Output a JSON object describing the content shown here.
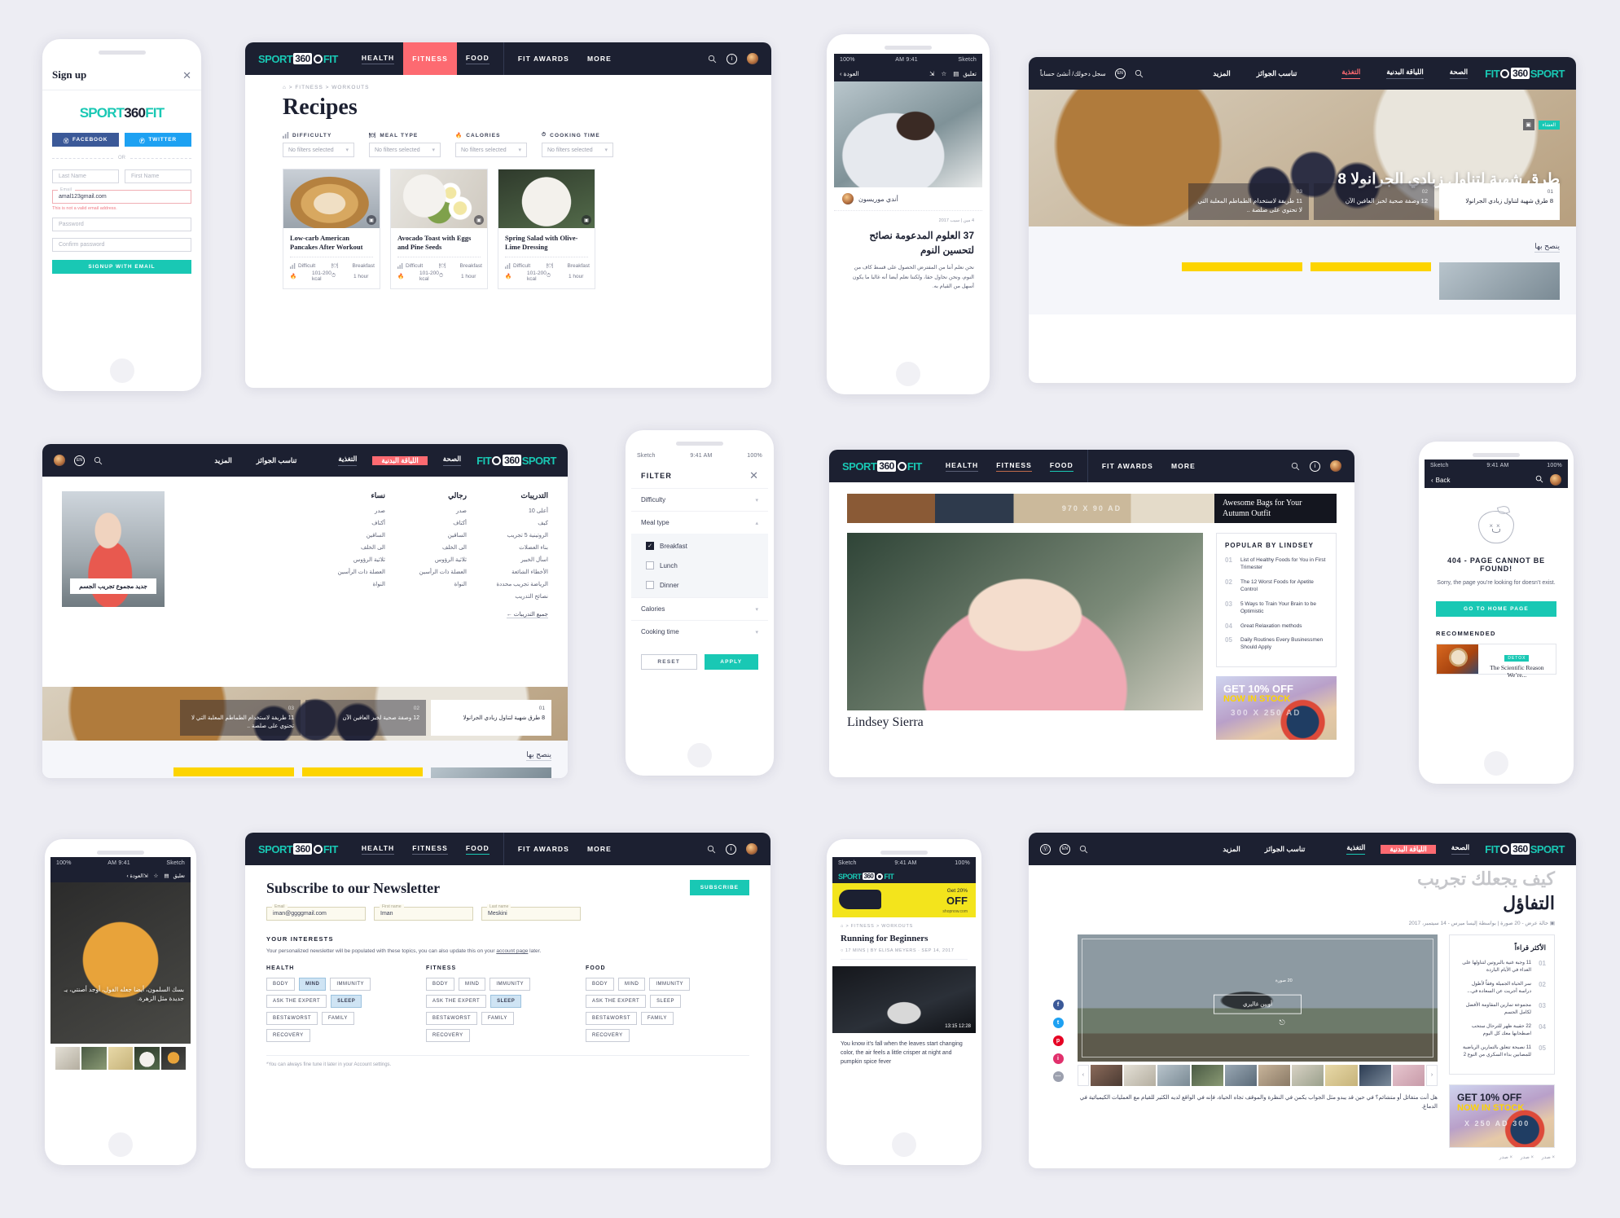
{
  "brand": {
    "part1": "SPORT",
    "part2": "360",
    "part3": "FIT",
    "accent": "#19c8b4",
    "dark": "#1c2031",
    "pink": "#fd6a71",
    "yellow": "#fdd400"
  },
  "status_bar": {
    "carrier": "Sketch",
    "time": "9:41 AM",
    "battery": "100%"
  },
  "signup": {
    "title": "Sign up",
    "close_icon": "close-icon",
    "facebook_label": "FACEBOOK",
    "twitter_label": "TWITTER",
    "or_label": "OR",
    "last_name_placeholder": "Last Name",
    "first_name_placeholder": "First Name",
    "email_label": "Email",
    "email_value": "amal123gmail.com",
    "email_error": "This is not a valid email address.",
    "password_placeholder": "Password",
    "confirm_placeholder": "Confirm password",
    "submit_label": "SIGNUP WITH EMAIL"
  },
  "desktop_nav": {
    "links": [
      "HEALTH",
      "FITNESS",
      "FOOD",
      "FIT AWARDS",
      "MORE"
    ],
    "active": "FITNESS",
    "search_icon": "search-icon",
    "info_icon": "info-icon",
    "avatar_icon": "avatar"
  },
  "recipes": {
    "breadcrumb": "⌂  >  FITNESS  >  WORKOUTS",
    "title": "Recipes",
    "filters": [
      {
        "icon": "bar-chart-icon",
        "label": "DIFFICULTY",
        "value": "No filters selected"
      },
      {
        "icon": "meal-icon",
        "label": "MEAL TYPE",
        "value": "No filters selected"
      },
      {
        "icon": "flame-icon",
        "label": "CALORIES",
        "value": "No filters selected"
      },
      {
        "icon": "clock-icon",
        "label": "COOKING TIME",
        "value": "No filters selected"
      }
    ],
    "cards": [
      {
        "title": "Low-carb American Pancakes After Workout",
        "difficulty": "Difficult",
        "meal": "Breakfast",
        "calories": "101-200 kcal",
        "time": "1 hour",
        "photo": "ph-pancake"
      },
      {
        "title": "Avocado Toast with Eggs and Pine Seeds",
        "difficulty": "Difficult",
        "meal": "Breakfast",
        "calories": "101-200 kcal",
        "time": "1 hour",
        "photo": "ph-avocado"
      },
      {
        "title": "Spring Salad with Olive-Lime Dressing",
        "difficulty": "Difficult",
        "meal": "Breakfast",
        "calories": "101-200 kcal",
        "time": "1 hour",
        "photo": "ph-salad"
      }
    ]
  },
  "sleep_article": {
    "back_label": "العودة",
    "comment_label": "تعليق",
    "star_icon": "star-icon",
    "share_icon": "share-icon",
    "author": "أندي موريسون",
    "meta": "4 مين | سيب 2017",
    "title": "37 العلوم المدعومة نصائح لتحسين النوم",
    "body": "نحن نعلم أننا من المفترض الحصول على قسط كاف من النوم، ونحن نحاول حقا، ولكننا نعلم أيضا أنه غالبا ما يكون أسهل من القيام به."
  },
  "arabic_nav": {
    "links": [
      "الصحة",
      "اللياقة البدنية",
      "التغذية",
      "تناسب الجوائز",
      "المزيد"
    ],
    "auth": "سجل دخولك/ أنشئ حساباً",
    "lang_badge": "EN",
    "search_icon": "search-icon"
  },
  "granola_hero": {
    "tag": "العشاء",
    "gallery_icon": "gallery-icon",
    "title": "8 طرق شهية لتناول زبادي الجرانولا",
    "cards": [
      {
        "n": "01",
        "text": "8 طرق شهية لتناول زبادي الجرانولا",
        "active": true
      },
      {
        "n": "02",
        "text": "12 وصفة صحية لخبز العافين الآن",
        "active": false
      },
      {
        "n": "03",
        "text": "11 طريفة لاستخدام الطماطم المعلبة التي لا تحتوي على صلصة ..",
        "active": false
      }
    ],
    "recommend_label": "ينصح بها"
  },
  "mega_menu": {
    "columns": [
      {
        "heading": "التدريبات",
        "items": [
          "أعلى 10",
          "كيف",
          "الروتينية 5 تجريب",
          "بناء العضلات",
          "اسأل الخبير",
          "الأخطاء الشائعة",
          "الرياضة تجريب محددة",
          "نصائح التدريب"
        ],
        "all_label": "جميع التدريبات ←"
      },
      {
        "heading": "رجالي",
        "items": [
          "صدر",
          "أكتاف",
          "الساقين",
          "الى الخلف",
          "ثلاثية الرؤوس",
          "العضلة ذات الرأسين",
          "النواة"
        ],
        "all_label": ""
      },
      {
        "heading": "نساء",
        "items": [
          "صدر",
          "أكتاف",
          "الساقين",
          "الى الخلف",
          "ثلاثية الرؤوس",
          "العضلة ذات الرأسين",
          "النواة"
        ],
        "all_label": ""
      }
    ],
    "promo_caption": "جديد مجموع تجريب الجسم"
  },
  "filter_panel": {
    "title": "FILTER",
    "close_icon": "close-icon",
    "rows": [
      {
        "label": "Difficulty",
        "state": "collapsed"
      },
      {
        "label": "Meal type",
        "state": "expanded"
      },
      {
        "label": "Calories",
        "state": "collapsed"
      },
      {
        "label": "Cooking time",
        "state": "collapsed"
      }
    ],
    "meal_options": [
      {
        "label": "Breakfast",
        "checked": true
      },
      {
        "label": "Lunch",
        "checked": false
      },
      {
        "label": "Dinner",
        "checked": false
      }
    ],
    "reset_label": "RESET",
    "apply_label": "APPLY"
  },
  "lindsey_page": {
    "ad_label": "970 X 90 AD",
    "ad_caption": "Awesome Bags for Your Autumn Outfit",
    "article_name": "Lindsey Sierra",
    "popular_heading": "POPULAR BY LINDSEY",
    "popular": [
      {
        "n": "01",
        "title": "List of Healthy Foods for You in First Trimester"
      },
      {
        "n": "02",
        "title": "The 12 Worst Foods for Apetite Control"
      },
      {
        "n": "03",
        "title": "5 Ways to Train Your Brain to be Optimistic"
      },
      {
        "n": "04",
        "title": "Great Relaxation methods"
      },
      {
        "n": "05",
        "title": "Daily Routines Every Businessmen Should Apply"
      }
    ],
    "ad_line1": "GET 10% OFF",
    "ad_line2": "NOW IN STOCK",
    "ad_line3": "300 X 250 AD"
  },
  "error_page": {
    "back_label": "Back",
    "search_icon": "search-icon",
    "avatar_icon": "avatar",
    "apple_icon": "sad-apple-icon",
    "heading": "404 - PAGE CANNOT BE FOUND!",
    "body": "Sorry, the page you’re looking for doesn’t exist.",
    "cta_label": "GO TO HOME PAGE",
    "recommended_label": "RECOMMENDED",
    "rec_tag": "DETOX",
    "rec_title": "The Scientific Reason We’re..."
  },
  "newsletter": {
    "title": "Subscribe to our Newsletter",
    "subscribe_label": "SUBSCRIBE",
    "fields": [
      {
        "label": "Email",
        "value": "iman@ggggmail.com"
      },
      {
        "label": "First name",
        "value": "Iman"
      },
      {
        "label": "Last name",
        "value": "Meskini"
      }
    ],
    "interests_heading": "YOUR INTERESTS",
    "interests_note_a": "Your personalized newsletter will be populated with these topics, you can also update this on your ",
    "interests_note_link": "account page",
    "interests_note_b": " later.",
    "columns": [
      {
        "heading": "HEALTH",
        "tags": [
          {
            "label": "BODY",
            "on": false
          },
          {
            "label": "MIND",
            "on": true
          },
          {
            "label": "IMMUNITY",
            "on": false
          },
          {
            "label": "ASK THE EXPERT",
            "on": false
          },
          {
            "label": "SLEEP",
            "on": true
          },
          {
            "label": "BEST&WORST",
            "on": false
          },
          {
            "label": "FAMILY",
            "on": false
          },
          {
            "label": "RECOVERY",
            "on": false
          }
        ]
      },
      {
        "heading": "FITNESS",
        "tags": [
          {
            "label": "BODY",
            "on": false
          },
          {
            "label": "MIND",
            "on": false
          },
          {
            "label": "IMMUNITY",
            "on": false
          },
          {
            "label": "ASK THE EXPERT",
            "on": false
          },
          {
            "label": "SLEEP",
            "on": true
          },
          {
            "label": "BEST&WORST",
            "on": false
          },
          {
            "label": "FAMILY",
            "on": false
          },
          {
            "label": "RECOVERY",
            "on": false
          }
        ]
      },
      {
        "heading": "FOOD",
        "tags": [
          {
            "label": "BODY",
            "on": false
          },
          {
            "label": "MIND",
            "on": false
          },
          {
            "label": "IMMUNITY",
            "on": false
          },
          {
            "label": "ASK THE EXPERT",
            "on": false
          },
          {
            "label": "SLEEP",
            "on": false
          },
          {
            "label": "BEST&WORST",
            "on": false
          },
          {
            "label": "FAMILY",
            "on": false
          },
          {
            "label": "RECOVERY",
            "on": false
          }
        ]
      }
    ],
    "footnote": "*You can always fine tune it later in your Account settings."
  },
  "paella_phone": {
    "back_label": "العودة",
    "comment_label": "تعليق",
    "caption": "بسك السلمون، أيضا جعله الفول، أوجد أصنتي، يـ جديدة مثل الزهرة."
  },
  "running_phone": {
    "ad_small": "Get 20%",
    "ad_big": "OFF",
    "ad_note": "shopnow.com",
    "breadcrumb": "⌂  >  FITNESS  >  WORKOUTS",
    "title": "Running for Beginners",
    "meta": "○ 17 MINS  |  BY ELISA MEYERS · SEP 14, 2017",
    "img_time": "13:15      12:28",
    "body": "You know it’s fall when the leaves start changing color, the air feels a little crisper at night and pumpkin spice fever"
  },
  "gallery_page": {
    "title_line1": "كيف يجعلك تجريب",
    "title_line2": "التفاؤل",
    "meta": "حالة عرض - 20 صورة  |  بواسطة إليسا ميرس - 14 سيتمبر، 2017",
    "most_read_heading": "الأكثر قراءاً",
    "most_read": [
      {
        "n": "01",
        "t": "11 وجبة غنية بالبروتين لتناولها على الغداء في الأيام الباردة"
      },
      {
        "n": "02",
        "t": "سر الحياة الجميلة وفقاً لأطول دراسة أجريت عن السعادة في..."
      },
      {
        "n": "03",
        "t": "مجموعة تمارين المقاومة الأفضل لكامل الجسم"
      },
      {
        "n": "04",
        "t": "22 حقيبة ظهر للترحال ستحب اصطحابها معك كل اليوم"
      },
      {
        "n": "05",
        "t": "11 نصيحة تتعلق بالتمارين الرياضية للمصابين بداء السكري من النوع 2"
      }
    ],
    "photo_caption": "أوبين غاليري",
    "photo_count": "20 صورة",
    "prev_icon": "chevron-left-icon",
    "next_icon": "chevron-right-icon",
    "paragraph": "هل أنت متفائل أو متشائم؟ في حين قد يبدو مثل الجواب يكمن في النظرة والموقف تجاه الحياة، فإنه في الواقع لديه الكثير للقيام مع العمليات الكيميائية في الدماغ.",
    "tags": [
      "× صدر",
      "× صدر",
      "× صدر"
    ],
    "social": [
      "f",
      "t",
      "p",
      "i",
      "⋯"
    ],
    "ad_line1": "GET 10% OFF",
    "ad_line2": "NOW IN STOCK",
    "ad_line3": "300 X 250 AD"
  }
}
